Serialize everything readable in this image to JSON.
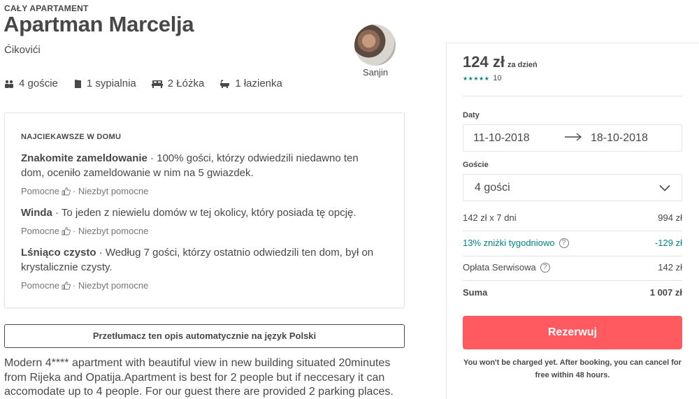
{
  "listing": {
    "kicker": "CAŁY APARTAMENT",
    "title": "Apartman Marcelja",
    "location": "Ćikovići",
    "host_name": "Sanjin",
    "facts": {
      "guests": "4 goście",
      "bedrooms": "1 sypialnia",
      "beds": "2 Łóżka",
      "baths": "1 łazienka"
    }
  },
  "highlights": {
    "kicker": "NAJCIEKAWSZE W DOMU",
    "helpful_label": "Pomocne",
    "not_helpful_label": "· Niezbyt pomocne",
    "items": [
      {
        "title": "Znakomite zameldowanie",
        "text": " · 100% gości, którzy odwiedzili niedawno ten dom, oceniło zameldowanie w nim na 5 gwiazdek."
      },
      {
        "title": "Winda",
        "text": " · To jeden z niewielu domów w tej okolicy, który posiada tę opcję."
      },
      {
        "title": "Lśniąco czysto",
        "text": " · Według 7 gości, którzy ostatnio odwiedzili ten dom, był on krystalicznie czysty."
      }
    ]
  },
  "translate_button": "Przetłumacz ten opis automatycznie na język Polski",
  "description": "Modern 4**** apartment with beautiful view in new building situated 20minutes from Rijeka and Opatija.Apartment is best for 2 people but if neccesary it can accomodate up to 4 people. For our guest there are provided 2 parking places.",
  "booking": {
    "price": "124 zł",
    "per": "za dzień",
    "stars": "★★★★★",
    "reviews": "10",
    "dates_label": "Daty",
    "check_in": "11-10-2018",
    "check_out": "18-10-2018",
    "guests_label": "Goście",
    "guests_value": "4 gości",
    "lines": {
      "nights_label": "142 zł x 7 dni",
      "nights_value": "994 zł",
      "discount_label": "13% zniżki tygodniowo",
      "discount_value": "-129 zł",
      "service_label": "Opłata Serwisowa",
      "service_value": "142 zł",
      "total_label": "Suma",
      "total_value": "1 007 zł"
    },
    "reserve_label": "Rezerwuj",
    "note": "You won't be charged yet. After booking, you can cancel for free within 48 hours.",
    "colors": {
      "accent": "#ff5a5f",
      "teal": "#008489"
    }
  }
}
